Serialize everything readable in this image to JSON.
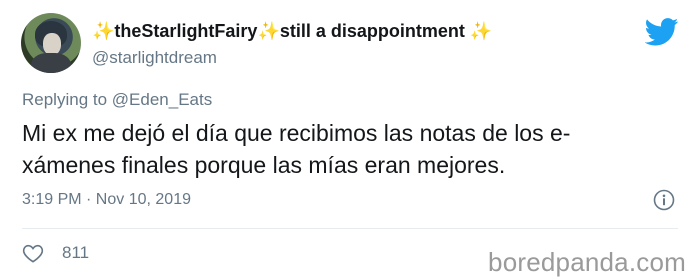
{
  "user": {
    "display_name_prefix_emoji": "✨",
    "display_name_main": "theStarlightFairy",
    "display_name_mid_emoji": "✨",
    "display_name_rest": "still a disappointment",
    "display_name_suffix_emoji": "✨",
    "handle": "@starlightdream"
  },
  "reply": {
    "prefix": "Replying to ",
    "mention": "@Eden_Eats"
  },
  "tweet": {
    "text": "Mi ex me dejó el día que recibimos las notas de los e-\nxámenes finales porque las mías eran mejores.",
    "timestamp": "3:19 PM · Nov 10, 2019"
  },
  "engagement": {
    "likes": "811"
  },
  "watermark": "boredpanda.com",
  "colors": {
    "brand": "#1da1f2",
    "muted": "#657786",
    "text": "#14171a",
    "sparkle": "#f5c518"
  },
  "icons": [
    "avatar",
    "twitter-bird-icon",
    "info-icon",
    "heart-icon"
  ]
}
